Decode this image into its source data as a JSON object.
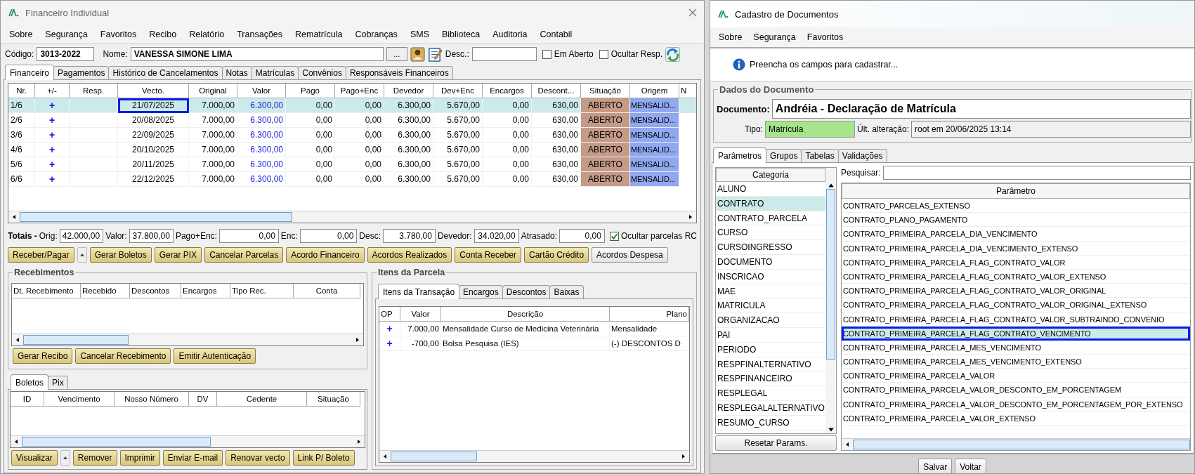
{
  "left_window": {
    "title": "Financeiro Individual",
    "menu": [
      "Sobre",
      "Segurança",
      "Favoritos",
      "Recibo",
      "Relatório",
      "Transações",
      "Rematrícula",
      "Cobranças",
      "SMS",
      "Biblioteca",
      "Auditoria",
      "Contabil"
    ],
    "codigo": {
      "label": "Código:",
      "value": "3013-2022"
    },
    "nome": {
      "label": "Nome:",
      "value": "VANESSA SIMONE LIMA"
    },
    "lookup_button": "...",
    "desc": {
      "label": "Desc.:"
    },
    "checks": [
      {
        "label": "Em Aberto",
        "checked": false
      },
      {
        "label": "Ocultar Resp.",
        "checked": false
      }
    ],
    "tabs": [
      {
        "label": "Financeiro",
        "selected": true
      },
      {
        "label": "Pagamentos",
        "selected": false
      },
      {
        "label": "Histórico de Cancelamentos",
        "selected": false
      },
      {
        "label": "Notas",
        "selected": false
      },
      {
        "label": "Matrículas",
        "selected": false
      },
      {
        "label": "Convênios",
        "selected": false
      },
      {
        "label": "Responsáveis Financeiros",
        "selected": false
      }
    ],
    "table": {
      "columns": [
        "Nr.",
        "+/-",
        "Resp.",
        "Vecto.",
        "Original",
        "Valor",
        "Pago",
        "Pago+Enc",
        "Devedor",
        "Dev+Enc",
        "Encargos",
        "Descont...",
        "Situação",
        "Origem",
        "N"
      ],
      "rows": [
        {
          "selected": true,
          "cells": [
            "1/6",
            "+",
            "",
            "21/07/2025",
            "7.000,00",
            "6.300,00",
            "0,00",
            "0,00",
            "6.300,00",
            "5.670,00",
            "0,00",
            "630,00",
            "ABERTO",
            "MENSALID..."
          ]
        },
        {
          "selected": false,
          "cells": [
            "2/6",
            "+",
            "",
            "20/08/2025",
            "7.000,00",
            "6.300,00",
            "0,00",
            "0,00",
            "6.300,00",
            "5.670,00",
            "0,00",
            "630,00",
            "ABERTO",
            "MENSALID..."
          ]
        },
        {
          "selected": false,
          "cells": [
            "3/6",
            "+",
            "",
            "22/09/2025",
            "7.000,00",
            "6.300,00",
            "0,00",
            "0,00",
            "6.300,00",
            "5.670,00",
            "0,00",
            "630,00",
            "ABERTO",
            "MENSALID..."
          ]
        },
        {
          "selected": false,
          "cells": [
            "4/6",
            "+",
            "",
            "20/10/2025",
            "7.000,00",
            "6.300,00",
            "0,00",
            "0,00",
            "6.300,00",
            "5.670,00",
            "0,00",
            "630,00",
            "ABERTO",
            "MENSALID..."
          ]
        },
        {
          "selected": false,
          "cells": [
            "5/6",
            "+",
            "",
            "20/11/2025",
            "7.000,00",
            "6.300,00",
            "0,00",
            "0,00",
            "6.300,00",
            "5.670,00",
            "0,00",
            "630,00",
            "ABERTO",
            "MENSALID..."
          ]
        },
        {
          "selected": false,
          "cells": [
            "6/6",
            "+",
            "",
            "22/12/2025",
            "7.000,00",
            "6.300,00",
            "0,00",
            "0,00",
            "6.300,00",
            "5.670,00",
            "0,00",
            "630,00",
            "ABERTO",
            "MENSALID..."
          ]
        }
      ]
    },
    "totals": {
      "title": "Totais -",
      "fields": [
        {
          "label": "Orig:",
          "value": "42.000,00"
        },
        {
          "label": "Valor:",
          "value": "37.800,00"
        },
        {
          "label": "Pago+Enc:",
          "value": "0,00"
        },
        {
          "label": "Enc:",
          "value": "0,00"
        },
        {
          "label": "Desc:",
          "value": "3.780,00"
        },
        {
          "label": "Devedor:",
          "value": "34.020,00"
        },
        {
          "label": "Atrasado:",
          "value": "0,00"
        }
      ],
      "check": {
        "label": "Ocultar parcelas RC",
        "checked": true
      }
    },
    "actions": [
      {
        "kind": "yellow",
        "label": "Receber/Pagar"
      },
      {
        "kind": "arrow"
      },
      {
        "kind": "yellow",
        "label": "Gerar Boletos"
      },
      {
        "kind": "yellow",
        "label": "Gerar PIX"
      },
      {
        "kind": "yellow",
        "label": "Cancelar Parcelas"
      },
      {
        "kind": "yellow",
        "label": "Acordo Financeiro"
      },
      {
        "kind": "yellow",
        "label": "Acordos Realizados"
      },
      {
        "kind": "yellow",
        "label": "Conta Receber"
      },
      {
        "kind": "yellow",
        "label": "Cartão Crédito"
      },
      {
        "kind": "plain",
        "label": "Acordos Despesa"
      }
    ],
    "recebimentos": {
      "title": "Recebimentos",
      "columns": [
        "Dt. Recebimento",
        "Recebido",
        "Descontos",
        "Encargos",
        "Tipo Rec.",
        "Conta"
      ],
      "buttons": [
        {
          "kind": "yellow",
          "label": "Gerar Recibo"
        },
        {
          "kind": "yellow",
          "label": "Cancelar Recebimento"
        },
        {
          "kind": "yellow",
          "label": "Emitir Autenticação"
        }
      ]
    },
    "boletos": {
      "tabs": [
        {
          "label": "Boletos",
          "selected": true
        },
        {
          "label": "Pix",
          "selected": false
        }
      ],
      "columns": [
        "ID",
        "Vencimento",
        "Nosso Número",
        "DV",
        "Cedente",
        "Situação"
      ],
      "buttons": [
        {
          "kind": "yellow",
          "label": "Visualizar"
        },
        {
          "kind": "arrow"
        },
        {
          "kind": "yellow",
          "label": "Remover"
        },
        {
          "kind": "yellow",
          "label": "Imprimir"
        },
        {
          "kind": "yellow",
          "label": "Enviar E-mail"
        },
        {
          "kind": "yellow",
          "label": "Renovar vecto"
        },
        {
          "kind": "yellow",
          "label": "Link P/ Boleto"
        }
      ]
    },
    "itens": {
      "title": "Itens da Parcela",
      "tabs": [
        {
          "label": "Itens da Transação",
          "selected": true
        },
        {
          "label": "Encargos",
          "selected": false
        },
        {
          "label": "Descontos",
          "selected": false
        },
        {
          "label": "Baixas",
          "selected": false
        }
      ],
      "columns": [
        "OP",
        "Valor",
        "Descrição",
        "Plano"
      ],
      "rows": [
        [
          "+",
          "7.000,00",
          "Mensalidade Curso de Medicina Veterinária",
          "Mensalidade"
        ],
        [
          "+",
          "-700,00",
          "Bolsa Pesquisa (IES)",
          "(-) DESCONTOS D"
        ]
      ]
    }
  },
  "right_window": {
    "title": "Cadastro de Documentos",
    "menu": [
      "Sobre",
      "Segurança",
      "Favoritos"
    ],
    "message": "Preencha os campos para cadastrar...",
    "group_title": "Dados do Documento",
    "documento": {
      "label": "Documento:",
      "value": "Andréia - Declaração de Matrícula"
    },
    "tipo": {
      "label": "Tipo:",
      "value": "Matrícula"
    },
    "alteracao": {
      "label": "Últ. alteração:",
      "value": "root em 20/06/2025 13:14"
    },
    "tabs": [
      {
        "label": "Parâmetros",
        "selected": true
      },
      {
        "label": "Grupos",
        "selected": false
      },
      {
        "label": "Tabelas",
        "selected": false
      },
      {
        "label": "Validações",
        "selected": false
      }
    ],
    "categoria": {
      "header": "Categoria",
      "items": [
        {
          "label": "ALUNO",
          "selected": false
        },
        {
          "label": "CONTRATO",
          "selected": true
        },
        {
          "label": "CONTRATO_PARCELA",
          "selected": false
        },
        {
          "label": "CURSO",
          "selected": false
        },
        {
          "label": "CURSOINGRESSO",
          "selected": false
        },
        {
          "label": "DOCUMENTO",
          "selected": false
        },
        {
          "label": "INSCRICAO",
          "selected": false
        },
        {
          "label": "MAE",
          "selected": false
        },
        {
          "label": "MATRICULA",
          "selected": false
        },
        {
          "label": "ORGANIZACAO",
          "selected": false
        },
        {
          "label": "PAI",
          "selected": false
        },
        {
          "label": "PERIODO",
          "selected": false
        },
        {
          "label": "RESPFINALTERNATIVO",
          "selected": false
        },
        {
          "label": "RESPFINANCEIRO",
          "selected": false
        },
        {
          "label": "RESPLEGAL",
          "selected": false
        },
        {
          "label": "RESPLEGALALTERNATIVO",
          "selected": false
        },
        {
          "label": "RESUMO_CURSO",
          "selected": false
        }
      ]
    },
    "reset_button": "Resetar Params.",
    "search": {
      "label": "Pesquisar:"
    },
    "parametro": {
      "header": "Parâmetro",
      "items": [
        {
          "label": "CONTRATO_PARCELAS_EXTENSO",
          "selected": false
        },
        {
          "label": "CONTRATO_PLANO_PAGAMENTO",
          "selected": false
        },
        {
          "label": "CONTRATO_PRIMEIRA_PARCELA_DIA_VENCIMENTO",
          "selected": false
        },
        {
          "label": "CONTRATO_PRIMEIRA_PARCELA_DIA_VENCIMENTO_EXTENSO",
          "selected": false
        },
        {
          "label": "CONTRATO_PRIMEIRA_PARCELA_FLAG_CONTRATO_VALOR",
          "selected": false
        },
        {
          "label": "CONTRATO_PRIMEIRA_PARCELA_FLAG_CONTRATO_VALOR_EXTENSO",
          "selected": false
        },
        {
          "label": "CONTRATO_PRIMEIRA_PARCELA_FLAG_CONTRATO_VALOR_ORIGINAL",
          "selected": false
        },
        {
          "label": "CONTRATO_PRIMEIRA_PARCELA_FLAG_CONTRATO_VALOR_ORIGINAL_EXTENSO",
          "selected": false
        },
        {
          "label": "CONTRATO_PRIMEIRA_PARCELA_FLAG_CONTRATO_VALOR_SUBTRAINDO_CONVENIO",
          "selected": false
        },
        {
          "label": "CONTRATO_PRIMEIRA_PARCELA_FLAG_CONTRATO_VENCIMENTO",
          "selected": true
        },
        {
          "label": "CONTRATO_PRIMEIRA_PARCELA_MES_VENCIMENTO",
          "selected": false
        },
        {
          "label": "CONTRATO_PRIMEIRA_PARCELA_MES_VENCIMENTO_EXTENSO",
          "selected": false
        },
        {
          "label": "CONTRATO_PRIMEIRA_PARCELA_VALOR",
          "selected": false
        },
        {
          "label": "CONTRATO_PRIMEIRA_PARCELA_VALOR_DESCONTO_EM_PORCENTAGEM",
          "selected": false
        },
        {
          "label": "CONTRATO_PRIMEIRA_PARCELA_VALOR_DESCONTO_EM_PORCENTAGEM_POR_EXTENSO",
          "selected": false
        },
        {
          "label": "CONTRATO_PRIMEIRA_PARCELA_VALOR_EXTENSO",
          "selected": false
        }
      ]
    },
    "footer_buttons": [
      "Salvar",
      "Voltar"
    ]
  }
}
